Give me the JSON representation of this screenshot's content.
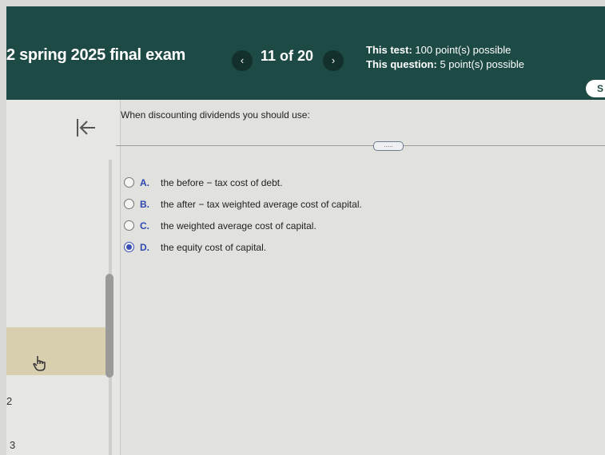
{
  "header": {
    "exam_title": "2 spring 2025 final exam",
    "prev_label": "‹",
    "counter": "11 of 20",
    "next_label": "›",
    "test_label": "This test:",
    "test_value": "100 point(s) possible",
    "question_label": "This question:",
    "question_value": "5 point(s) possible",
    "edge_label": "S"
  },
  "sidebar": {
    "collapse_icon": "collapse-left-arrow-icon",
    "pointer_icon": "hand-pointer-icon",
    "num_2": "2",
    "num_3": "3"
  },
  "question": {
    "text": "When discounting dividends you should use:",
    "more_label": "....."
  },
  "options": [
    {
      "letter": "A.",
      "text": "the before − tax cost of debt.",
      "selected": false
    },
    {
      "letter": "B.",
      "text": "the after − tax weighted average cost of capital.",
      "selected": false
    },
    {
      "letter": "C.",
      "text": "the weighted average cost of capital.",
      "selected": false
    },
    {
      "letter": "D.",
      "text": "the equity cost of capital.",
      "selected": true
    }
  ],
  "colors": {
    "header_bg": "#1e4a45",
    "accent": "#3a4fb5"
  }
}
